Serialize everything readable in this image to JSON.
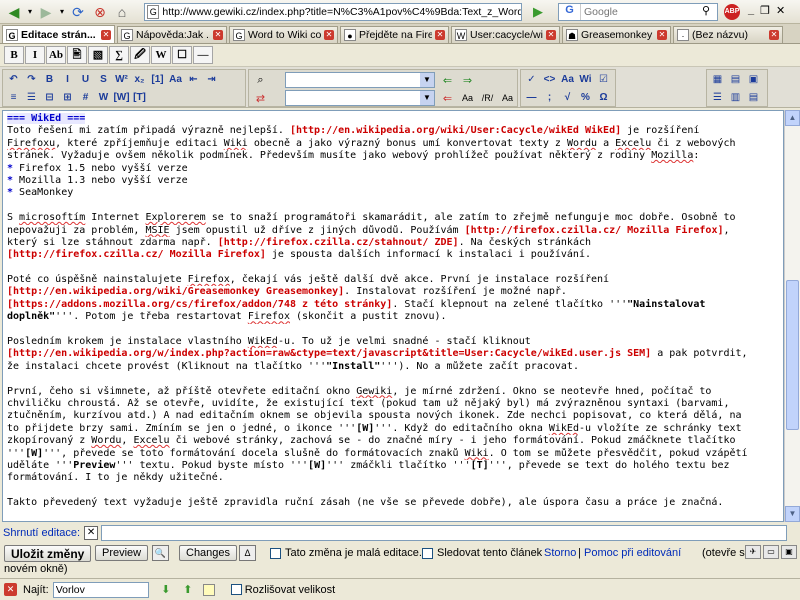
{
  "browser": {
    "url": "http://www.gewiki.cz/index.php?title=N%C3%A1pov%C4%9Bda:Text_z_Wordu_do_Gewi",
    "url_favicon": "G",
    "search_engine": "G",
    "search_placeholder": "Google",
    "adblock_label": "ABP",
    "tabs": [
      {
        "label": "Editace strán...",
        "icon": "G"
      },
      {
        "label": "Nápověda:Jak ...",
        "icon": "G"
      },
      {
        "label": "Word to Wiki co...",
        "icon": "G"
      },
      {
        "label": "Přejděte na Fire...",
        "icon": "●"
      },
      {
        "label": "User:cacycle/wi...",
        "icon": "W"
      },
      {
        "label": "Greasemonkey ...",
        "icon": "☗"
      },
      {
        "label": "(Bez názvu)",
        "icon": "·"
      }
    ]
  },
  "editor_lines": [
    [
      {
        "t": "=== WikEd ===",
        "c": "heading"
      }
    ],
    [
      {
        "t": "Toto řešení mi zatím připadá výrazně nejlepší. "
      },
      {
        "t": "[http://en.wikipedia.org/wiki/User:Cacycle/wikEd ",
        "c": "link"
      },
      {
        "t": "WikEd]",
        "c": "link bold"
      },
      {
        "t": " je rozšíření"
      }
    ],
    [
      {
        "t": "Firefoxu",
        "c": "sp"
      },
      {
        "t": ", které zpříjemňuje editaci "
      },
      {
        "t": "Wiki",
        "c": "sp"
      },
      {
        "t": " obecně a jako výrazný bonus umí konvertovat texty z "
      },
      {
        "t": "Wordu",
        "c": "sp"
      },
      {
        "t": " a "
      },
      {
        "t": "Excelu",
        "c": "sp"
      },
      {
        "t": " či z webových"
      }
    ],
    [
      {
        "t": "stránek. Vyžaduje  ovšem několik podmínek. Především musíte jako webový prohlížeč používat některý z rodiny "
      },
      {
        "t": "Mozilla",
        "c": "sp"
      },
      {
        "t": ":"
      }
    ],
    [
      {
        "t": "* ",
        "c": "listmark"
      },
      {
        "t": "Firefox 1.5 nebo vyšší verze"
      }
    ],
    [
      {
        "t": "* ",
        "c": "listmark"
      },
      {
        "t": "Mozilla 1.3 nebo vyšší verze"
      }
    ],
    [
      {
        "t": "* ",
        "c": "listmark"
      },
      {
        "t": "SeaMonkey"
      }
    ],
    [],
    [
      {
        "t": "S "
      },
      {
        "t": "microsoftím",
        "c": "sp"
      },
      {
        "t": " Internet "
      },
      {
        "t": "Explorerem",
        "c": "sp"
      },
      {
        "t": " se to snaží programátoři skamarádit, ale zatím to zřejmě nefunguje moc dobře. Osobně to"
      }
    ],
    [
      {
        "t": "nepovažuji za problém, "
      },
      {
        "t": "MSIE",
        "c": "sp"
      },
      {
        "t": " jsem opustil už dříve z jiných důvodů. Používám "
      },
      {
        "t": "[http://firefox.czilla.cz/ ",
        "c": "link"
      },
      {
        "t": "Mozilla Firefox]",
        "c": "link bold"
      },
      {
        "t": ","
      }
    ],
    [
      {
        "t": "který si lze stáhnout zdarma např. "
      },
      {
        "t": "[http://firefox.czilla.cz/stahnout/ ",
        "c": "link"
      },
      {
        "t": "ZDE]",
        "c": "link bold"
      },
      {
        "t": ". Na českých stránkách"
      }
    ],
    [
      {
        "t": "[http://firefox.czilla.cz/ ",
        "c": "link"
      },
      {
        "t": "Mozilla Firefox]",
        "c": "link bold"
      },
      {
        "t": " je spousta dalších informací k instalaci i používání."
      }
    ],
    [],
    [
      {
        "t": "Poté co úspěšně nainstalujete "
      },
      {
        "t": "Firefox",
        "c": "sp"
      },
      {
        "t": ", čekají vás ještě další dvě akce. První je instalace rozšíření"
      }
    ],
    [
      {
        "t": "[http://en.wikipedia.org/wiki/Greasemonkey ",
        "c": "link"
      },
      {
        "t": "Greasemonkey]",
        "c": "link bold"
      },
      {
        "t": ". Instalovat rozšíření je možné např."
      }
    ],
    [
      {
        "t": "[https://addons.mozilla.org/cs/firefox/addon/748 ",
        "c": "link"
      },
      {
        "t": "z této stránky]",
        "c": "link bold"
      },
      {
        "t": ". Stačí klepnout na zelené tlačítko '''"
      },
      {
        "t": "\"Nainstalovat",
        "c": "bold"
      }
    ],
    [
      {
        "t": "doplněk\"",
        "c": "bold"
      },
      {
        "t": "'''. Potom je třeba restartovat "
      },
      {
        "t": "Firefox",
        "c": "sp"
      },
      {
        "t": " (skončit a pustit znovu)."
      }
    ],
    [],
    [
      {
        "t": "Posledním krokem je instalace vlastního "
      },
      {
        "t": "WikEd",
        "c": "sp"
      },
      {
        "t": "-u. To už je velmi snadné - stačí  kliknout"
      }
    ],
    [
      {
        "t": "[http://en.wikipedia.org/w/index.php?action=raw&ctype=text/javascript&title=User:Cacycle/wikEd.user.js ",
        "c": "link"
      },
      {
        "t": "SEM]",
        "c": "link bold"
      },
      {
        "t": " a pak potvrdit,"
      }
    ],
    [
      {
        "t": "že instalaci chcete provést (Kliknout na tlačítko '''"
      },
      {
        "t": "\"Install\"",
        "c": "bold"
      },
      {
        "t": "'''). No a můžete začít pracovat."
      }
    ],
    [],
    [
      {
        "t": "První, čeho si všimnete, až příště otevřete editační okno "
      },
      {
        "t": "Gewiki",
        "c": "sp"
      },
      {
        "t": ", je mírné zdržení. Okno se neotevře hned, počítač to"
      }
    ],
    [
      {
        "t": "chviličku chroustá. Až se otevře, uvidíte, že existující text (pokud tam už nějaký byl) má zvýrazněnou syntaxi (barvami,"
      }
    ],
    [
      {
        "t": "ztučněním, kurzívou atd.) A nad editačním oknem se objevila spousta nových ikonek. Zde nechci popisovat, co která dělá, na"
      }
    ],
    [
      {
        "t": "to přijdete brzy sami. Zmíním se jen o jedné, o ikonce '''"
      },
      {
        "t": "[W]",
        "c": "bold"
      },
      {
        "t": "'''. Když do editačního okna "
      },
      {
        "t": "WikEd",
        "c": "sp"
      },
      {
        "t": "-u vložíte ze schránky text"
      }
    ],
    [
      {
        "t": "zkopírovaný z "
      },
      {
        "t": "Wordu",
        "c": "sp"
      },
      {
        "t": ", "
      },
      {
        "t": "Excelu",
        "c": "sp"
      },
      {
        "t": " či webové stránky, zachová se - do značné míry - i jeho formátování. Pokud zmáčknete tlačítko"
      }
    ],
    [
      {
        "t": "'''"
      },
      {
        "t": "[W]",
        "c": "bold"
      },
      {
        "t": "''', převede se toto formátování docela slušně do formátovacích znaků "
      },
      {
        "t": "Wiki",
        "c": "sp"
      },
      {
        "t": ". O tom se můžete přesvědčit, pokud vzápětí"
      }
    ],
    [
      {
        "t": "uděláte '''"
      },
      {
        "t": "Preview",
        "c": "bold"
      },
      {
        "t": "''' textu. Pokud byste místo '''"
      },
      {
        "t": "[W]",
        "c": "bold"
      },
      {
        "t": "''' zmáčkli tlačítko '''"
      },
      {
        "t": "[T]",
        "c": "bold"
      },
      {
        "t": "''', převede se text do holého textu bez"
      }
    ],
    [
      {
        "t": "formátování. I to je někdy užitečné."
      }
    ],
    [],
    [
      {
        "t": "Takto převedený text vyžaduje ještě zpravidla ruční zásah (ne vše se převede dobře), ale úspora času a práce je značná."
      }
    ]
  ],
  "wiki_toolbar": [
    "B",
    "I",
    "Ab",
    "🖹",
    "▧",
    "∑",
    "🖉",
    "W",
    "☐",
    "—"
  ],
  "wiked": {
    "row1_a": [
      "↶",
      "↷",
      "B",
      "I",
      "U",
      "S",
      "W²",
      "x₂",
      "[1]",
      "Aa",
      "⇤",
      "⇥"
    ],
    "row2_a": [
      "≡",
      "☰",
      "⊟",
      "⊞",
      "#",
      "W",
      "[W]",
      "[T]"
    ],
    "row1_b": [
      "✓",
      "<>",
      "Aa",
      "Wi",
      "☑"
    ],
    "row2_b": [
      "—",
      ";",
      "√",
      "%",
      "Ω"
    ],
    "row1_c": [
      "▦",
      "▤",
      "▣"
    ],
    "row2_c": [
      "☰",
      "▥",
      "▤"
    ]
  },
  "summary": {
    "label": "Shrnutí editace:",
    "value": ""
  },
  "actions": {
    "save": "Uložit změny",
    "preview": "Preview",
    "changes": "Changes",
    "minor_edit": "Tato změna je malá editace.",
    "watch": "Sledovat tento článek",
    "cancel": "Storno",
    "separator": "|",
    "help": "Pomoc při editování",
    "help_note": "(otevře se v",
    "help_note2": "novém okně)"
  },
  "findbar": {
    "label": "Najít:",
    "value": "Vorlov",
    "match_case": "Rozlišovat velikost"
  }
}
